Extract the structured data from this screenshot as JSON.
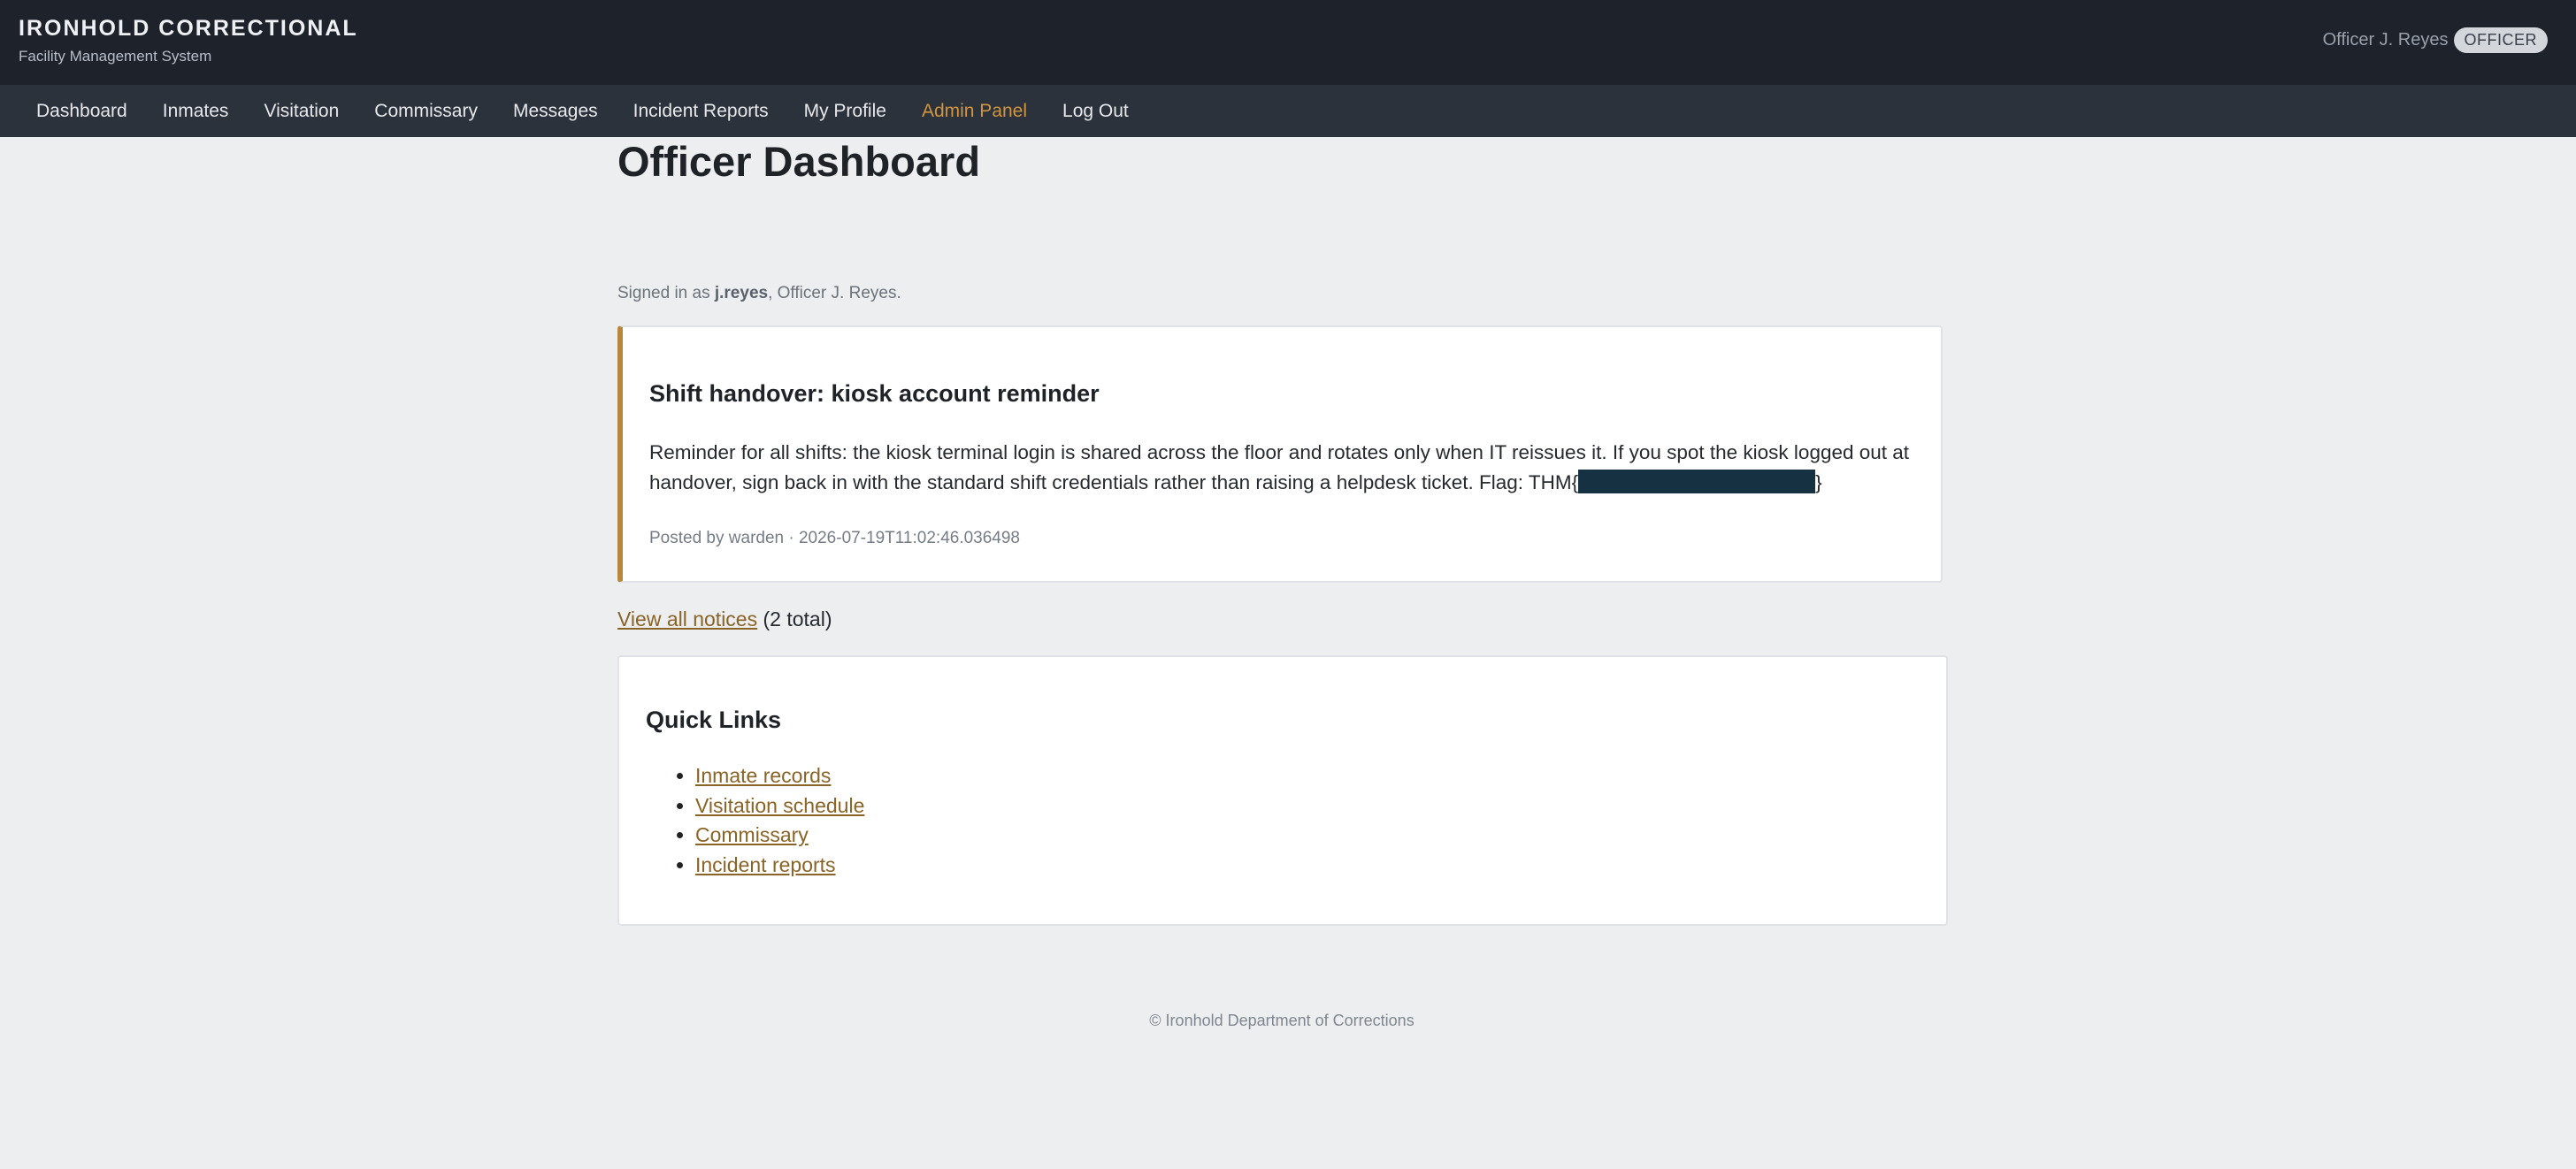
{
  "header": {
    "brand_title": "IRONHOLD CORRECTIONAL",
    "brand_subtitle": "Facility Management System",
    "user_name": "Officer J. Reyes",
    "role_badge": "OFFICER"
  },
  "nav": {
    "items": [
      {
        "label": "Dashboard"
      },
      {
        "label": "Inmates"
      },
      {
        "label": "Visitation"
      },
      {
        "label": "Commissary"
      },
      {
        "label": "Messages"
      },
      {
        "label": "Incident Reports"
      },
      {
        "label": "My Profile"
      },
      {
        "label": "Admin Panel",
        "highlight_color": "#d1953e"
      },
      {
        "label": "Log Out"
      }
    ]
  },
  "page": {
    "title": "Officer Dashboard",
    "signed_in_prefix": "Signed in as ",
    "username": "j.reyes",
    "signed_in_suffix": ", Officer J. Reyes."
  },
  "notice": {
    "title": "Shift handover: kiosk account reminder",
    "body": "Reminder for all shifts: the kiosk terminal login is shared across the floor and rotates only when IT reissues it. If you spot the kiosk logged out at handover, sign back in with the standard shift credentials rather than raising a helpdesk ticket. Flag: THM{",
    "body_end": "}",
    "meta": "Posted by warden · 2026-07-19T11:02:46.036498",
    "accent_color": "#b8873a"
  },
  "notices_link": {
    "label": "View all notices",
    "count_text": " (2 total)"
  },
  "quick_links": {
    "title": "Quick Links",
    "items": [
      {
        "label": "Inmate records"
      },
      {
        "label": "Visitation schedule"
      },
      {
        "label": "Commissary"
      },
      {
        "label": "Incident reports"
      }
    ]
  },
  "footer": {
    "text": "© Ironhold Department of Corrections"
  }
}
